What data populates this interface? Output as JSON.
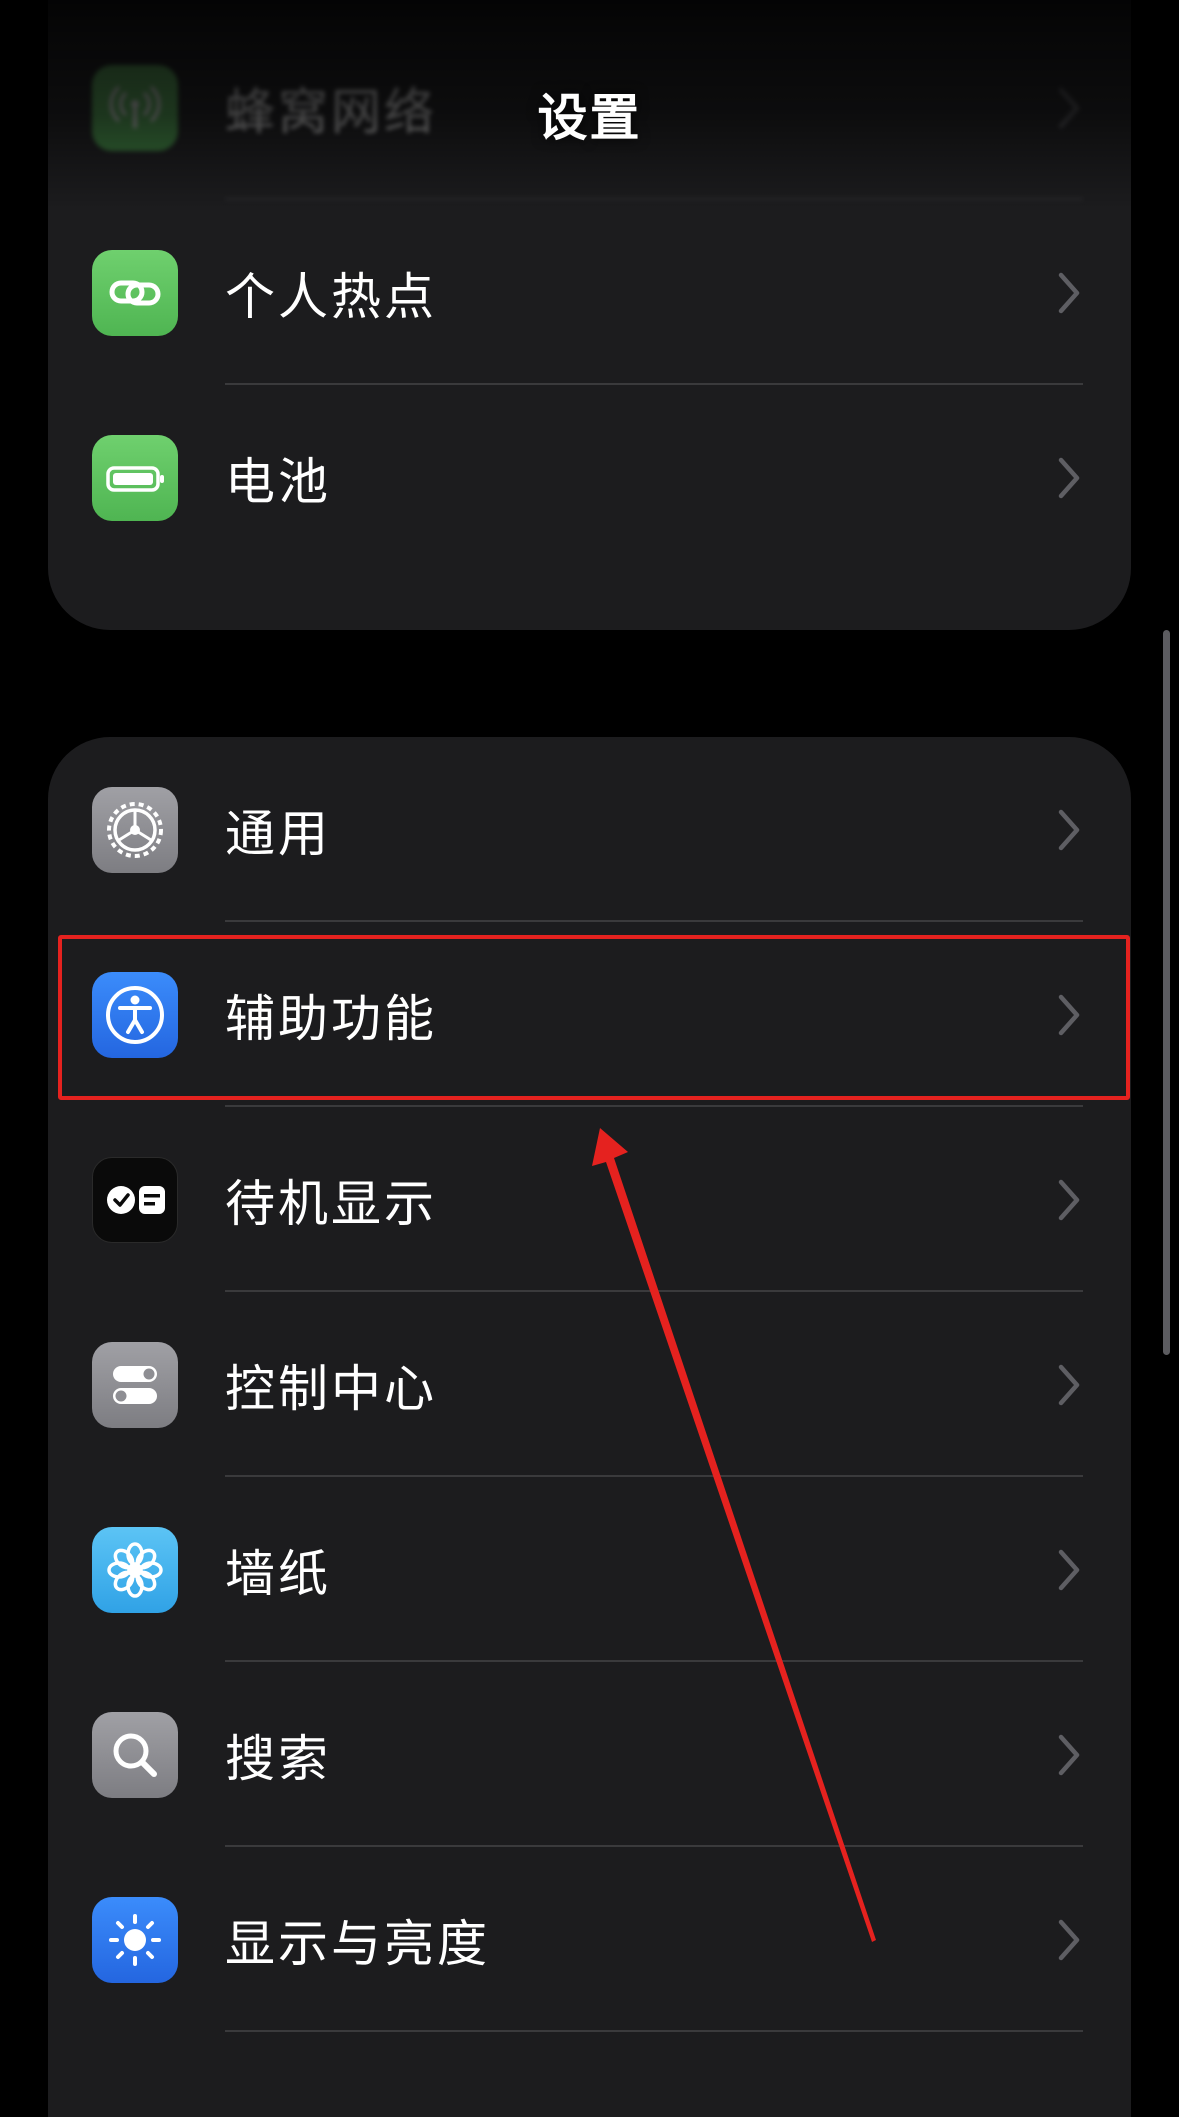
{
  "header": {
    "title": "设置"
  },
  "group1": {
    "items": [
      {
        "label": "蜂窝网络",
        "icon": "cellular-antenna-icon",
        "color": "#65c466"
      },
      {
        "label": "个人热点",
        "icon": "hotspot-link-icon",
        "color": "#65c466"
      },
      {
        "label": "电池",
        "icon": "battery-icon",
        "color": "#65c466"
      }
    ]
  },
  "group2": {
    "items": [
      {
        "label": "通用",
        "icon": "gear-icon",
        "color": "#8e8e93"
      },
      {
        "label": "辅助功能",
        "icon": "accessibility-icon",
        "color": "#2f7cf6"
      },
      {
        "label": "待机显示",
        "icon": "standby-icon",
        "color": "#0a0a0a"
      },
      {
        "label": "控制中心",
        "icon": "toggles-icon",
        "color": "#8e8e93"
      },
      {
        "label": "墙纸",
        "icon": "flower-icon",
        "color": "#46b5f0"
      },
      {
        "label": "搜索",
        "icon": "magnifier-icon",
        "color": "#8e8e93"
      },
      {
        "label": "显示与亮度",
        "icon": "sun-icon",
        "color": "#2f7cf6"
      }
    ]
  },
  "annotation": {
    "highlight_color": "#e5221f",
    "target": "辅助功能"
  }
}
